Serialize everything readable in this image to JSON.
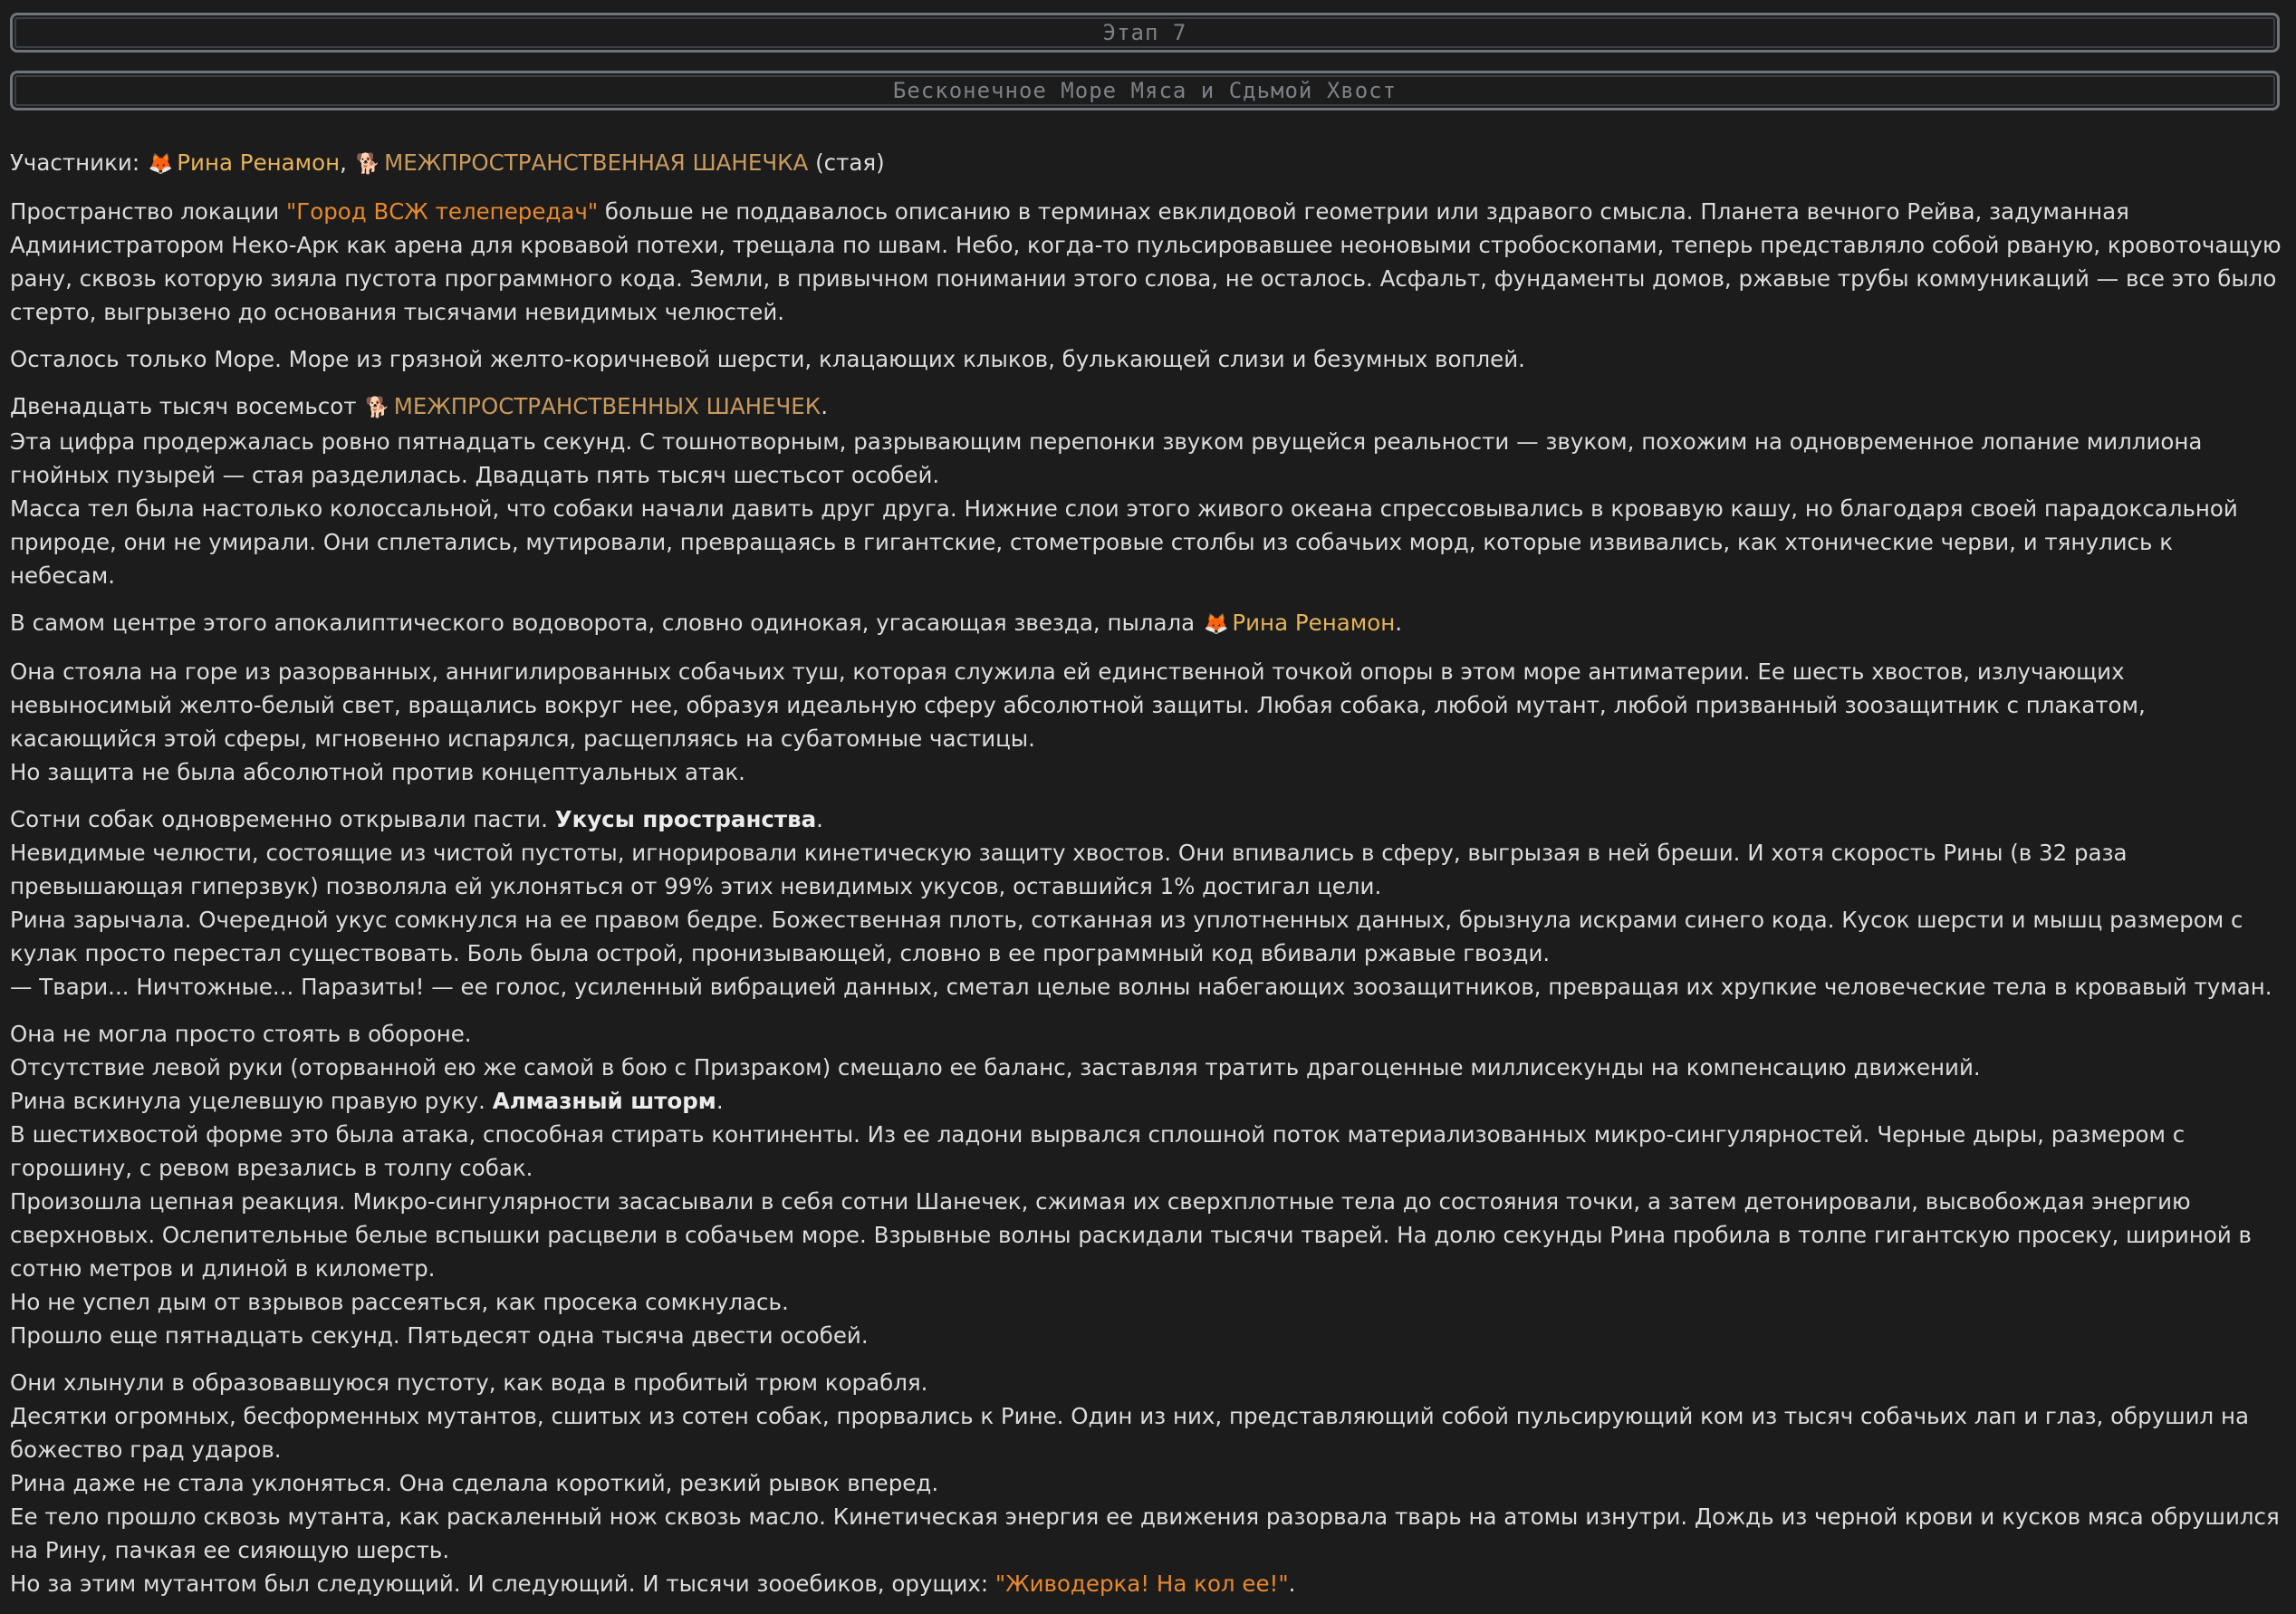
{
  "header": {
    "stage": "Этап 7",
    "title": "Бесконечное Море Мяса и Сдьмой Хвост"
  },
  "participants": {
    "label": "Участники:",
    "rina_icon": "🦊",
    "rina": "Рина Ренамон",
    "sep": ",",
    "dog_icon": "🐕",
    "dogs": "МЕЖПРОСТРАНСТВЕННАЯ ШАНЕЧКА",
    "suffix": "(стая)"
  },
  "p1": {
    "a": "Пространство локации ",
    "loc": "\"Город ВСЖ телепередач\"",
    "b": " больше не поддавалось описанию в терминах евклидовой геометрии или здравого смысла. Планета вечного Рейва, задуманная Администратором Неко-Арк как арена для кровавой потехи, трещала по швам. Небо, когда-то пульсировавшее неоновыми стробоскопами, теперь представляло собой рваную, кровоточащую рану, сквозь которую зияла пустота программного кода. Земли, в привычном понимании этого слова, не осталось. Асфальт, фундаменты домов, ржавые трубы коммуникаций — все это было стерто, выгрызено до основания тысячами невидимых челюстей."
  },
  "p2": "Осталось только Море. Море из грязной желто-коричневой шерсти, клацающих клыков, булькающей слизи и безумных воплей.",
  "p3": {
    "a": "Двенадцать тысяч восемьсот",
    "dog_icon": "🐕",
    "dogs": "МЕЖПРОСТРАНСТВЕННЫХ ШАНЕЧЕК",
    "dot": ".",
    "l2": "Эта цифра продержалась ровно пятнадцать секунд. С тошнотворным, разрывающим перепонки звуком рвущейся реальности — звуком, похожим на одновременное лопание миллиона гнойных пузырей — стая разделилась. Двадцать пять тысяч шестьсот особей.",
    "l3": "Масса тел была настолько колоссальной, что собаки начали давить друг друга. Нижние слои этого живого океана спрессовывались в кровавую кашу, но благодаря своей парадоксальной природе, они не умирали. Они сплетались, мутировали, превращаясь в гигантские, стометровые столбы из собачьих морд, которые извивались, как хтонические черви, и тянулись к небесам."
  },
  "p4": {
    "a": "В самом центре этого апокалиптического водоворота, словно одинокая, угасающая звезда, пылала",
    "rina_icon": "🦊",
    "rina": "Рина Ренамон",
    "dot": "."
  },
  "p5": {
    "l1": "Она стояла на горе из разорванных, аннигилированных собачьих туш, которая служила ей единственной точкой опоры в этом море антиматерии. Ее шесть хвостов, излучающих невыносимый желто-белый свет, вращались вокруг нее, образуя идеальную сферу абсолютной защиты. Любая собака, любой мутант, любой призванный зоозащитник с плакатом, касающийся этой сферы, мгновенно испарялся, расщепляясь на субатомные частицы.",
    "l2": "Но защита не была абсолютной против концептуальных атак."
  },
  "p6": {
    "a": "Сотни собак одновременно открывали пасти. ",
    "bold": "Укусы пространства",
    "dot": ".",
    "l2": "Невидимые челюсти, состоящие из чистой пустоты, игнорировали кинетическую защиту хвостов. Они впивались в сферу, выгрызая в ней бреши. И хотя скорость Рины (в 32 раза превышающая гиперзвук) позволяла ей уклоняться от 99% этих невидимых укусов, оставшийся 1% достигал цели.",
    "l3": "Рина зарычала. Очередной укус сомкнулся на ее правом бедре. Божественная плоть, сотканная из уплотненных данных, брызнула искрами синего кода. Кусок шерсти и мышц размером с кулак просто перестал существовать. Боль была острой, пронизывающей, словно в ее программный код вбивали ржавые гвозди.",
    "l4": "— Твари... Ничтожные... Паразиты! — ее голос, усиленный вибрацией данных, сметал целые волны набегающих зоозащитников, превращая их хрупкие человеческие тела в кровавый туман."
  },
  "p7": {
    "l1": "Она не могла просто стоять в обороне.",
    "l2": "Отсутствие левой руки (оторванной ею же самой в бою с Призраком) смещало ее баланс, заставляя тратить драгоценные миллисекунды на компенсацию движений.",
    "l3a": "Рина вскинула уцелевшую правую руку. ",
    "l3bold": "Алмазный шторм",
    "l3dot": ".",
    "l4": "В шестихвостой форме это была атака, способная стирать континенты. Из ее ладони вырвался сплошной поток материализованных микро-сингулярностей. Черные дыры, размером с горошину, с ревом врезались в толпу собак.",
    "l5": "Произошла цепная реакция. Микро-сингулярности засасывали в себя сотни Шанечек, сжимая их сверхплотные тела до состояния точки, а затем детонировали, высвобождая энергию сверхновых. Ослепительные белые вспышки расцвели в собачьем море. Взрывные волны раскидали тысячи тварей. На долю секунды Рина пробила в толпе гигантскую просеку, шириной в сотню метров и длиной в километр.",
    "l6": "Но не успел дым от взрывов рассеяться, как просека сомкнулась.",
    "l7": "Прошло еще пятнадцать секунд. Пятьдесят одна тысяча двести особей."
  },
  "p8": {
    "l1": "Они хлынули в образовавшуюся пустоту, как вода в пробитый трюм корабля.",
    "l2": "Десятки огромных, бесформенных мутантов, сшитых из сотен собак, прорвались к Рине. Один из них, представляющий собой пульсирующий ком из тысяч собачьих лап и глаз, обрушил на божество град ударов.",
    "l3": "Рина даже не стала уклоняться. Она сделала короткий, резкий рывок вперед.",
    "l4": "Ее тело прошло сквозь мутанта, как раскаленный нож сквозь масло. Кинетическая энергия ее движения разорвала тварь на атомы изнутри. Дождь из черной крови и кусков мяса обрушился на Рину, пачкая ее сияющую шерсть.",
    "l5a": "Но за этим мутантом был следующий. И следующий. И тысячи зооебиков, орущих: ",
    "l5quote": "\"Живодерка! На кол ее!\"",
    "l5dot": "."
  },
  "colors": {
    "background": "#1c1c1c",
    "text": "#dcdcdc",
    "orange": "#e8892e",
    "gold": "#e6b35a",
    "tan": "#c99a5e",
    "header_text": "#7d8186"
  }
}
